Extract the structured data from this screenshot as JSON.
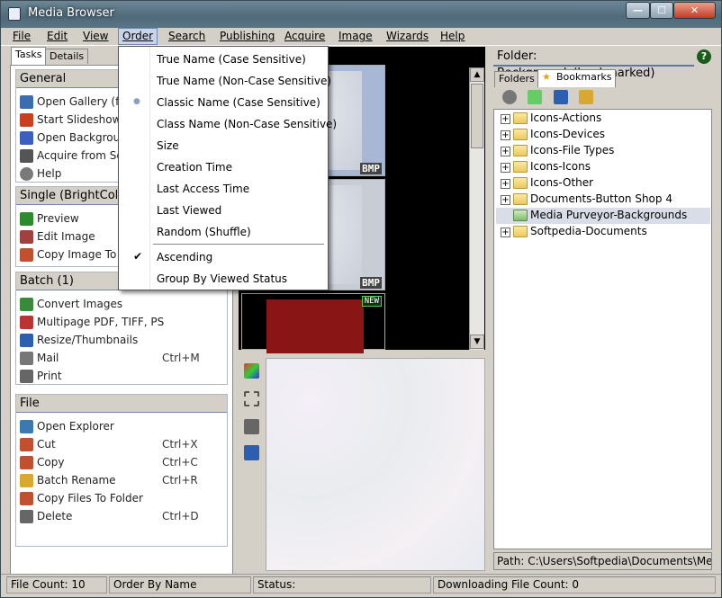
{
  "window": {
    "title": "Media Browser",
    "min_label": "—",
    "max_label": "☐",
    "close_label": "✕"
  },
  "menubar": {
    "items": [
      "File",
      "Edit",
      "View",
      "Order",
      "Search",
      "Publishing",
      "Acquire",
      "Image",
      "Wizards",
      "Help"
    ]
  },
  "left": {
    "tabs": [
      "Tasks",
      "Details"
    ],
    "general": {
      "title": "General",
      "items": [
        {
          "label": "Open Gallery (full",
          "icon": "gallery-icon",
          "color": "#3a6db0"
        },
        {
          "label": "Start Slideshow",
          "icon": "slideshow-icon",
          "color": "#c84020"
        },
        {
          "label": "Open Background",
          "icon": "music-icon",
          "color": "#3a5fbf"
        },
        {
          "label": "Acquire from Sca",
          "icon": "scanner-icon",
          "color": "#555555"
        },
        {
          "label": "Help",
          "icon": "help-icon",
          "color": "#7a7a7a"
        }
      ]
    },
    "single": {
      "title": "Single (BrightColor",
      "items": [
        {
          "label": "Preview",
          "icon": "preview-icon",
          "color": "#2d8a2d"
        },
        {
          "label": "Edit Image",
          "icon": "edit-image-icon",
          "color": "#a04040"
        },
        {
          "label": "Copy Image To C",
          "icon": "copy-image-icon",
          "color": "#c05030"
        }
      ]
    },
    "batch": {
      "title": "Batch (1)",
      "items": [
        {
          "label": "Convert Images",
          "shortcut": "",
          "icon": "convert-icon",
          "color": "#3a8a3a"
        },
        {
          "label": "Multipage PDF, TIFF, PS",
          "shortcut": "",
          "icon": "pdf-icon",
          "color": "#bb3333"
        },
        {
          "label": "Resize/Thumbnails",
          "shortcut": "",
          "icon": "resize-icon",
          "color": "#2d5fb0"
        },
        {
          "label": "Mail",
          "shortcut": "Ctrl+M",
          "icon": "mail-icon",
          "color": "#777777"
        },
        {
          "label": "Print",
          "shortcut": "",
          "icon": "print-icon",
          "color": "#666666"
        }
      ]
    },
    "file": {
      "title": "File",
      "items": [
        {
          "label": "Open Explorer",
          "shortcut": "",
          "icon": "explorer-icon",
          "color": "#3a7ab0"
        },
        {
          "label": "Cut",
          "shortcut": "Ctrl+X",
          "icon": "cut-icon",
          "color": "#c05030"
        },
        {
          "label": "Copy",
          "shortcut": "Ctrl+C",
          "icon": "copy-icon",
          "color": "#c05030"
        },
        {
          "label": "Batch Rename",
          "shortcut": "Ctrl+R",
          "icon": "rename-icon",
          "color": "#d8a830"
        },
        {
          "label": "Copy Files To Folder",
          "shortcut": "",
          "icon": "copy-folder-icon",
          "color": "#c05030"
        },
        {
          "label": "Delete",
          "shortcut": "Ctrl+D",
          "icon": "delete-icon",
          "color": "#666666"
        }
      ]
    }
  },
  "gallery": {
    "thumbs": [
      {
        "format": "BMP",
        "badge": ""
      },
      {
        "format": "BMP",
        "badge": ""
      },
      {
        "format": "",
        "badge": "NEW"
      }
    ],
    "scroll_up": "▲",
    "scroll_down": "▼"
  },
  "order_menu": {
    "items": [
      {
        "label": "True Name (Case Sensitive)",
        "checked": ""
      },
      {
        "label": "True Name (Non-Case Sensitive)",
        "checked": ""
      },
      {
        "label": "Classic Name (Case Sensitive)",
        "checked": "●"
      },
      {
        "label": "Class Name (Non-Case Sensitive)",
        "checked": ""
      },
      {
        "label": "Size",
        "checked": ""
      },
      {
        "label": "Creation Time",
        "checked": ""
      },
      {
        "label": "Last Access Time",
        "checked": ""
      },
      {
        "label": "Last Viewed",
        "checked": ""
      },
      {
        "label": "Random (Shuffle)",
        "checked": ""
      },
      {
        "label": "Ascending",
        "checked": "✔"
      },
      {
        "label": "Group By Viewed Status",
        "checked": ""
      }
    ]
  },
  "right": {
    "folder_title": "Folder: Backgrounds(bookmarked)",
    "help_glyph": "?",
    "tabs": [
      "Folders",
      "Bookmarks"
    ],
    "tree": [
      {
        "label": "Icons-Actions",
        "expand": "+"
      },
      {
        "label": "Icons-Devices",
        "expand": "+"
      },
      {
        "label": "Icons-File Types",
        "expand": "+"
      },
      {
        "label": "Icons-Icons",
        "expand": "+"
      },
      {
        "label": "Icons-Other",
        "expand": "+"
      },
      {
        "label": "Documents-Button Shop 4",
        "expand": "+"
      },
      {
        "label": "Media Purveyor-Backgrounds",
        "expand": ""
      },
      {
        "label": "Softpedia-Documents",
        "expand": "+"
      }
    ],
    "path": "Path: C:\\Users\\Softpedia\\Documents\\Media"
  },
  "status": {
    "file_count": "File Count: 10",
    "order_by": "Order By Name",
    "status": "Status:",
    "downloading": "Downloading File Count: 0"
  }
}
